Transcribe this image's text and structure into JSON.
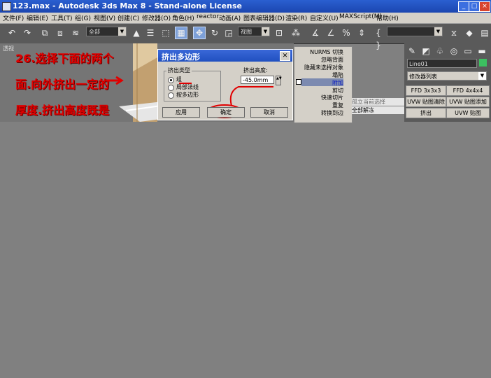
{
  "window": {
    "title": "123.max - Autodesk 3ds Max 8 - Stand-alone License"
  },
  "menubar": [
    "文件(F)",
    "编辑(E)",
    "工具(T)",
    "组(G)",
    "视图(V)",
    "创建(C)",
    "修改器(O)",
    "角色(H)",
    "reactor",
    "动画(A)",
    "图表编辑器(D)",
    "渲染(R)",
    "自定义(U)",
    "MAXScript(M)",
    "帮助(H)"
  ],
  "toolbar": {
    "selection_filter": "全部",
    "ref_coord": "视图"
  },
  "viewport": {
    "label": "透视",
    "tutorial": [
      "26.选择下面的两个",
      "面.向外挤出一定的",
      "厚度.挤出高度既是"
    ]
  },
  "dialog": {
    "title": "挤出多边形",
    "group_label": "挤出类型",
    "options": [
      "组",
      "局部法线",
      "按多边形"
    ],
    "selected_option": "组",
    "height_label": "挤出高度:",
    "height_value": "-45.0mm",
    "apply": "应用",
    "ok": "确定",
    "cancel": "取消"
  },
  "midpanel": {
    "items": [
      "NURMS 切换",
      "忽略背面",
      "隐藏未选择对象",
      "塌陷",
      "附加",
      "剪切",
      "快速切片",
      "重复",
      "转换到边"
    ],
    "highlighted": "附加",
    "sub": [
      "孤立当前选择",
      "全部解冻"
    ]
  },
  "cmdpanel": {
    "object_name": "Line01",
    "modifier_list": "修改器列表",
    "buttons": [
      "FFD 3x3x3",
      "FFD 4x4x4",
      "UVW 贴图清除",
      "UVW 贴图添加",
      "挤出",
      "UVW 贴图"
    ]
  }
}
